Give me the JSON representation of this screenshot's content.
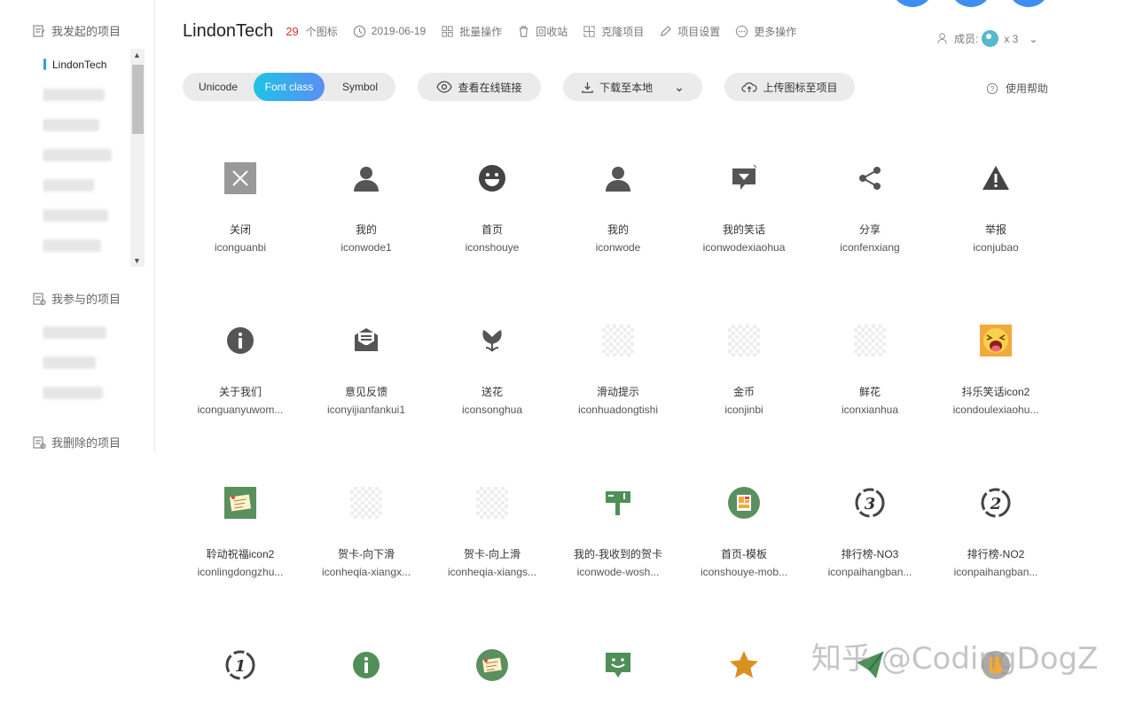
{
  "sidebar": {
    "section_created": "我发起的项目",
    "section_joined": "我参与的项目",
    "section_deleted": "我删除的项目",
    "created_items": [
      {
        "label": "LindonTech",
        "active": true
      },
      {
        "label": "",
        "blurred": true
      },
      {
        "label": "",
        "blurred": true
      },
      {
        "label": "",
        "blurred": true
      },
      {
        "label": "",
        "blurred": true
      },
      {
        "label": "",
        "blurred": true
      },
      {
        "label": "",
        "blurred": true
      }
    ],
    "joined_items": [
      {
        "label": "",
        "blurred": true
      },
      {
        "label": "",
        "blurred": true
      },
      {
        "label": "",
        "blurred": true
      }
    ]
  },
  "header": {
    "project_name": "LindonTech",
    "icon_count": "29",
    "icon_count_unit": "个图标",
    "date": "2019-06-19",
    "batch_ops": "批量操作",
    "recycle_bin": "回收站",
    "clone_project": "克隆项目",
    "project_settings": "项目设置",
    "more_ops": "更多操作",
    "members_label": "成员:",
    "members_count": "x 3"
  },
  "toolbar": {
    "tabs": [
      "Unicode",
      "Font class",
      "Symbol"
    ],
    "active_tab": "Font class",
    "view_online_link": "查看在线链接",
    "download_local": "下载至本地",
    "upload_icons": "上传图标至项目",
    "help": "使用帮助"
  },
  "icons": [
    {
      "name": "关闭",
      "code": "iconguanbi",
      "glyph": "close-icon"
    },
    {
      "name": "我的",
      "code": "iconwode1",
      "glyph": "user-icon"
    },
    {
      "name": "首页",
      "code": "iconshouye",
      "glyph": "smile-icon"
    },
    {
      "name": "我的",
      "code": "iconwode",
      "glyph": "user-icon"
    },
    {
      "name": "我的笑话",
      "code": "iconwodexiaohua",
      "glyph": "joke-icon"
    },
    {
      "name": "分享",
      "code": "iconfenxiang",
      "glyph": "share-icon"
    },
    {
      "name": "举报",
      "code": "iconjubao",
      "glyph": "warning-icon"
    },
    {
      "name": "关于我们",
      "code": "iconguanyuwom...",
      "glyph": "info-icon"
    },
    {
      "name": "意见反馈",
      "code": "iconyijianfankui1",
      "glyph": "feedback-icon"
    },
    {
      "name": "送花",
      "code": "iconsonghua",
      "glyph": "flower-icon"
    },
    {
      "name": "滑动提示",
      "code": "iconhuadongtishi",
      "glyph": "transparent-icon"
    },
    {
      "name": "金币",
      "code": "iconjinbi",
      "glyph": "transparent-icon"
    },
    {
      "name": "鲜花",
      "code": "iconxianhua",
      "glyph": "transparent-icon"
    },
    {
      "name": "抖乐笑话icon2",
      "code": "icondoulexiaohu...",
      "glyph": "laugh-face-icon"
    },
    {
      "name": "聆动祝福icon2",
      "code": "iconlingdongzhu...",
      "glyph": "greeting-card-icon"
    },
    {
      "name": "贺卡-向下滑",
      "code": "iconheqia-xiangx...",
      "glyph": "transparent-icon"
    },
    {
      "name": "贺卡-向上滑",
      "code": "iconheqia-xiangs...",
      "glyph": "transparent-icon"
    },
    {
      "name": "我的-我收到的贺卡",
      "code": "iconwode-wosh...",
      "glyph": "mailbox-icon"
    },
    {
      "name": "首页-模板",
      "code": "iconshouye-mob...",
      "glyph": "template-icon"
    },
    {
      "name": "排行榜-NO3",
      "code": "iconpaihangban...",
      "glyph": "rank-3-icon"
    },
    {
      "name": "排行榜-NO2",
      "code": "iconpaihangban...",
      "glyph": "rank-2-icon"
    },
    {
      "name": "",
      "code": "",
      "glyph": "rank-1-icon"
    },
    {
      "name": "",
      "code": "",
      "glyph": "info-green-icon"
    },
    {
      "name": "",
      "code": "",
      "glyph": "greeting-card-round-icon"
    },
    {
      "name": "",
      "code": "",
      "glyph": "chat-smile-icon"
    },
    {
      "name": "",
      "code": "",
      "glyph": "star-icon"
    },
    {
      "name": "",
      "code": "",
      "glyph": "paper-plane-icon"
    },
    {
      "name": "",
      "code": "",
      "glyph": "misc-icon"
    }
  ],
  "watermark": "知乎 @CodingDogZ"
}
